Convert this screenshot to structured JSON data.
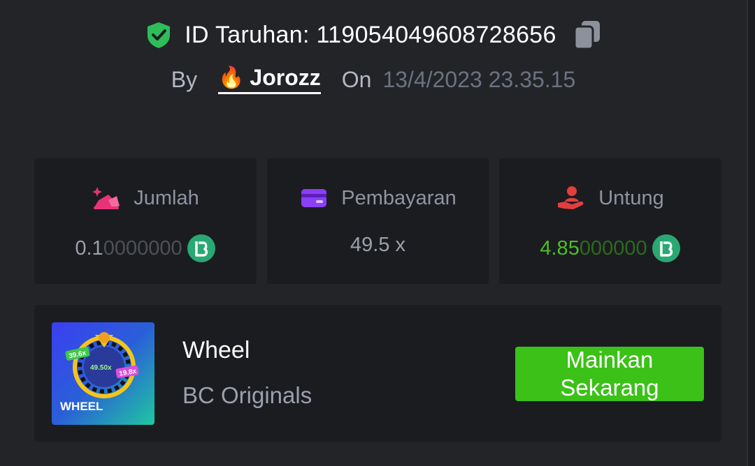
{
  "bet": {
    "id_label": "ID Taruhan:",
    "id_value": "119054049608728656",
    "by_label": "By",
    "user_emoji": "🔥",
    "username": "Jorozz",
    "on_label": "On",
    "datetime": "13/4/2023 23.35.15"
  },
  "stats": {
    "amount": {
      "label": "Jumlah",
      "value_main": "0.1",
      "value_trailing": "0000000",
      "icon": "bet-amount-icon"
    },
    "payout": {
      "label": "Pembayaran",
      "value": "49.5 x",
      "icon": "payout-card-icon"
    },
    "profit": {
      "label": "Untung",
      "value_main": "4.85",
      "value_trailing": "000000",
      "icon": "profit-hand-icon"
    }
  },
  "game": {
    "name": "Wheel",
    "provider": "BC Originals",
    "play_label": "Mainkan Sekarang",
    "thumb_title": "WHEEL",
    "thumb_labels": [
      "39.6x",
      "49.50x",
      "19.8x"
    ]
  },
  "colors": {
    "background": "#232428",
    "card": "#1b1c20",
    "accent_green": "#3bc117",
    "profit_green": "#4fbe26",
    "verified_green": "#2ebd59",
    "bet_icon_pink": "#e8337a",
    "payout_icon_purple": "#8b3ff5",
    "profit_icon_red": "#e33e3e",
    "coin_green": "#2aa873"
  }
}
